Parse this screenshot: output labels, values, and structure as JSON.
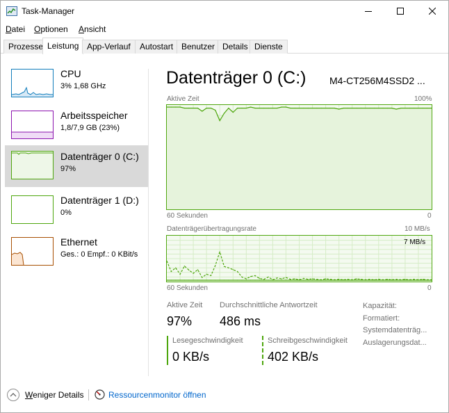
{
  "window": {
    "title": "Task-Manager",
    "icon": "task-manager-icon",
    "controls": [
      "minimize-icon",
      "maximize-icon",
      "close-icon"
    ]
  },
  "menu": {
    "file": {
      "mnemonic": "D",
      "rest": "atei"
    },
    "options": {
      "mnemonic": "O",
      "rest": "ptionen"
    },
    "view": {
      "mnemonic": "A",
      "rest": "nsicht"
    }
  },
  "tabs": [
    {
      "label": "Prozesse",
      "active": false
    },
    {
      "label": "Leistung",
      "active": true
    },
    {
      "label": "App-Verlauf",
      "active": false
    },
    {
      "label": "Autostart",
      "active": false
    },
    {
      "label": "Benutzer",
      "active": false
    },
    {
      "label": "Details",
      "active": false
    },
    {
      "label": "Dienste",
      "active": false
    }
  ],
  "sidebar": {
    "items": [
      {
        "title": "CPU",
        "subtitle": "3%  1,68 GHz",
        "color": "#117dbb",
        "selected": false
      },
      {
        "title": "Arbeitsspeicher",
        "subtitle": "1,8/7,9 GB (23%)",
        "color": "#8b12ae",
        "selected": false
      },
      {
        "title": "Datenträger 0 (C:)",
        "subtitle": "97%",
        "color": "#4da60c",
        "selected": true
      },
      {
        "title": "Datenträger 1 (D:)",
        "subtitle": "0%",
        "color": "#4da60c",
        "selected": false
      },
      {
        "title": "Ethernet",
        "subtitle": "Ges.: 0  Empf.: 0 KBit/s",
        "color": "#a74f01",
        "selected": false
      }
    ]
  },
  "detail": {
    "title": "Datenträger 0 (C:)",
    "model": "M4-CT256M4SSD2 ...",
    "active_time_graph": {
      "label": "Aktive Zeit",
      "max_label": "100%",
      "x_label": "60 Sekunden",
      "min_label": "0"
    },
    "transfer_graph": {
      "label": "Datenträgerübertragungsrate",
      "max_label": "10 MB/s",
      "inner_label": "7 MB/s",
      "x_label": "60 Sekunden",
      "min_label": "0"
    },
    "stats": {
      "active_time_label": "Aktive Zeit",
      "active_time_value": "97%",
      "response_label": "Durchschnittliche Antwortzeit",
      "response_value": "486 ms",
      "read_label": "Lesegeschwindigkeit",
      "read_value": "0 KB/s",
      "write_label": "Schreibgeschwindigkeit",
      "write_value": "402 KB/s"
    },
    "properties": [
      "Kapazität:",
      "Formatiert:",
      "Systemdatenträg...",
      "Auslagerungsdat..."
    ]
  },
  "footer": {
    "fewer_details": {
      "mnemonic": "W",
      "rest": "eniger Details"
    },
    "resource_monitor": "Ressourcenmonitor öffnen"
  },
  "chart_data": [
    {
      "type": "line",
      "title": "Aktive Zeit",
      "xlabel": "60 Sekunden",
      "ylim": [
        0,
        100
      ],
      "unit": "%",
      "color": "#4da60c",
      "grid": true,
      "x": [
        60,
        59,
        58,
        57,
        56,
        55,
        54,
        53,
        52,
        51,
        50,
        49,
        48,
        47,
        46,
        45,
        44,
        43,
        42,
        41,
        40,
        39,
        38,
        37,
        36,
        35,
        34,
        33,
        32,
        31,
        30,
        29,
        28,
        27,
        26,
        25,
        24,
        23,
        22,
        21,
        20,
        19,
        18,
        17,
        16,
        15,
        14,
        13,
        12,
        11,
        10,
        9,
        8,
        7,
        6,
        5,
        4,
        3,
        2,
        1,
        0
      ],
      "series": [
        {
          "values": [
            98,
            98,
            98,
            98,
            97,
            97,
            97,
            97,
            94,
            97,
            97,
            95,
            85,
            92,
            97,
            93,
            97,
            97,
            97,
            98,
            97,
            97,
            97,
            97,
            97,
            97,
            98,
            98,
            97,
            97,
            97,
            97,
            97,
            97,
            97,
            97,
            97,
            97,
            97,
            96,
            97,
            97,
            97,
            97,
            97,
            97,
            97,
            97,
            97,
            97,
            97,
            97,
            96,
            97,
            97,
            97,
            97,
            97,
            97,
            97,
            97
          ]
        }
      ]
    },
    {
      "type": "line",
      "title": "Datenträgerübertragungsrate",
      "xlabel": "60 Sekunden",
      "ylim": [
        0,
        10
      ],
      "unit": "MB/s",
      "color": "#4da60c",
      "grid": true,
      "x": [
        60,
        59,
        58,
        57,
        56,
        55,
        54,
        53,
        52,
        51,
        50,
        49,
        48,
        47,
        46,
        45,
        44,
        43,
        42,
        41,
        40,
        39,
        38,
        37,
        36,
        35,
        34,
        33,
        32,
        31,
        30,
        29,
        28,
        27,
        26,
        25,
        24,
        23,
        22,
        21,
        20,
        19,
        18,
        17,
        16,
        15,
        14,
        13,
        12,
        11,
        10,
        9,
        8,
        7,
        6,
        5,
        4,
        3,
        2,
        1,
        0
      ],
      "series": [
        {
          "name": "Lesegeschwindigkeit",
          "dash": false,
          "values": [
            0.3,
            0.3,
            0.3,
            0.3,
            0.3,
            0.3,
            0.3,
            0.3,
            0.3,
            0.3,
            0.3,
            0.3,
            0.3,
            0.3,
            0.3,
            0.3,
            0.3,
            0.3,
            0.3,
            0.3,
            0.3,
            0.3,
            0.3,
            0.3,
            0.3,
            0.3,
            0.3,
            0.3,
            0.3,
            0.3,
            0.3,
            0.3,
            0.3,
            0.3,
            0.3,
            0.3,
            0.3,
            0.3,
            0.3,
            0.3,
            0.3,
            0.3,
            0.3,
            0.3,
            0.3,
            0.3,
            0.3,
            0.3,
            0.3,
            0.3,
            0.3,
            0.3,
            0.3,
            0.3,
            0.3,
            0.3,
            0.3,
            0.3,
            0.3,
            0.3,
            0.3
          ]
        },
        {
          "name": "Schreibgeschwindigkeit",
          "dash": true,
          "values": [
            4.5,
            2.2,
            3.0,
            1.6,
            3.4,
            2.5,
            1.8,
            2.6,
            0.9,
            1.6,
            1.3,
            3.5,
            6.5,
            3.3,
            3.0,
            2.6,
            2.2,
            1.0,
            0.6,
            1.1,
            1.3,
            0.7,
            0.5,
            1.0,
            0.4,
            0.8,
            0.6,
            0.9,
            0.5,
            0.6,
            0.4,
            0.7,
            0.5,
            0.6,
            0.5,
            0.4,
            0.6,
            0.5,
            0.4,
            0.5,
            0.4,
            0.5,
            0.4,
            0.6,
            0.5,
            0.4,
            0.5,
            0.4,
            0.5,
            0.4,
            0.5,
            0.4,
            0.5,
            0.4,
            0.5,
            0.4,
            0.5,
            0.4,
            0.5,
            0.4,
            0.4
          ]
        }
      ]
    }
  ]
}
